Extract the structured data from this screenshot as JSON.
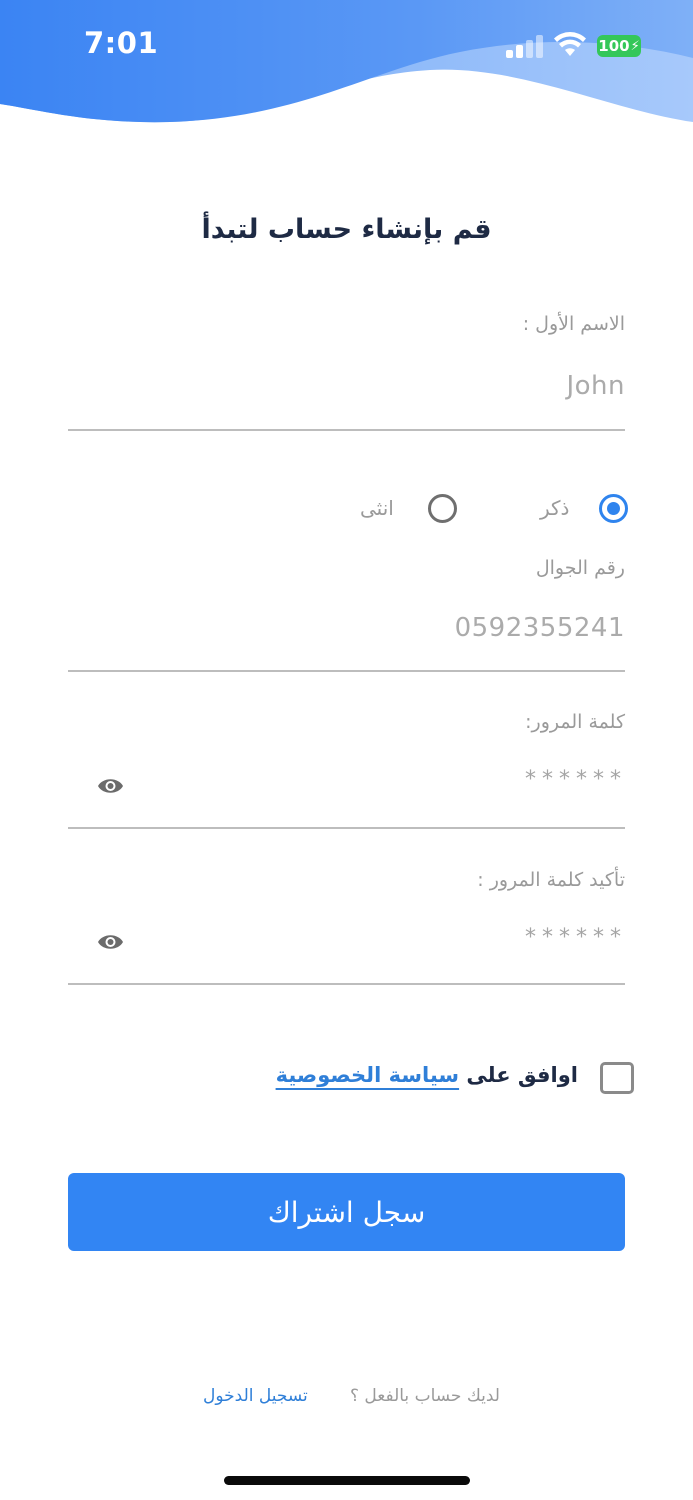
{
  "status_bar": {
    "time": "7:01",
    "battery": "100"
  },
  "form": {
    "title": "قم بإنشاء حساب لتبدأ",
    "first_name": {
      "label": "الاسم الأول :",
      "value": "John"
    },
    "gender": {
      "male_label": "ذكر",
      "female_label": "انثى",
      "selected": "male"
    },
    "mobile": {
      "label": "رقم الجوال",
      "value": "0592355241"
    },
    "password": {
      "label": "كلمة المرور:",
      "value": "******"
    },
    "confirm_password": {
      "label": "تأكيد كلمة المرور :",
      "value": "******"
    },
    "agree": {
      "prefix": "اوافق على",
      "policy_link": "سياسة الخصوصية",
      "checked": false
    },
    "submit_label": "سجل اشتراك"
  },
  "footer": {
    "question": "لديك حساب بالفعل ؟",
    "login_link": "تسجيل الدخول"
  },
  "colors": {
    "primary": "#3285f3",
    "header_gradient_start": "#3e86f3",
    "header_gradient_end": "#8fb9f8"
  },
  "icons": [
    "signal-icon",
    "wifi-icon",
    "battery-icon",
    "eye-icon"
  ]
}
